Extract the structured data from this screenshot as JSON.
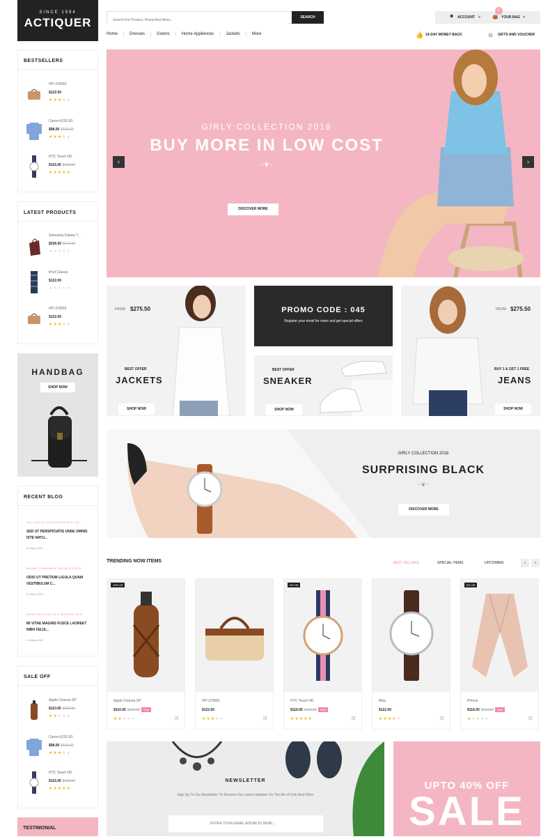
{
  "brand": {
    "since": "SINCE 1994",
    "name": "ACTIQUER"
  },
  "search": {
    "placeholder": "Search For Product, Brand And More...",
    "button": "SEARCH"
  },
  "header": {
    "account": "ACCOUNT",
    "bag": "YOUR BAG",
    "bag_count": "0",
    "perk1": "14-DAY MONEY BACK",
    "perk2": "GIFTS AND VOUCHER"
  },
  "nav": [
    "Home",
    "Dresses",
    "Gowns",
    "Home Appliences",
    "Jackets",
    "More"
  ],
  "bestsellers": {
    "title": "BESTSELLERS",
    "items": [
      {
        "name": "HP LP3065",
        "price": "$122.00",
        "old": "",
        "stars": 3
      },
      {
        "name": "Canon EOS 5D",
        "price": "$98.00",
        "old": "$122.00",
        "stars": 3
      },
      {
        "name": "HTC Touch HD",
        "price": "$116.00",
        "old": "$122.00",
        "stars": 5
      }
    ]
  },
  "latest": {
    "title": "LATEST PRODUCTS",
    "items": [
      {
        "name": "Samsung Galaxy T...",
        "price": "$236.00",
        "old": "$241.00",
        "stars": 0
      },
      {
        "name": "iPod Classic",
        "price": "$122.00",
        "old": "",
        "stars": 0
      },
      {
        "name": "HP LP3065",
        "price": "$122.00",
        "old": "",
        "stars": 3
      }
    ]
  },
  "handbag": {
    "title": "HANDBAG",
    "button": "SHOP NOW"
  },
  "blog": {
    "title": "RECENT BLOG",
    "posts": [
      {
        "cat": "NULLAM ULLAMCORPER NISI QU...",
        "title": "SED UT PERSPICIATIS UNDE OMNIS ISTE NATU...",
        "date": "21-May-2018"
      },
      {
        "cat": "MORBI CONDIMENTUM MOLESTIE",
        "title": "ODIO UT PRETIUM LIGULA QUAM VESTIBULUM C...",
        "date": "21-May-2018"
      },
      {
        "cat": "URNA PRETIUM ELIT MAURIS CUR...",
        "title": "MI VITAE MAGNIS FUSCE LAOREET NIBH FELIS...",
        "date": "21-May-2018"
      }
    ]
  },
  "saleoff": {
    "title": "SALE OFF",
    "items": [
      {
        "name": "Apple Cinema 30\"",
        "price": "$110.00",
        "old": "$122.00",
        "stars": 2
      },
      {
        "name": "Canon EOS 5D",
        "price": "$98.00",
        "old": "$122.00",
        "stars": 3
      },
      {
        "name": "HTC Touch HD",
        "price": "$116.00",
        "old": "$122.00",
        "stars": 5
      }
    ]
  },
  "testimonial": {
    "title": "TESTIMONIAL"
  },
  "hero": {
    "sub": "GIRLY COLLECTION 2018",
    "title": "BUY MORE IN LOW COST",
    "button": "DISCOVER MORE"
  },
  "banners": {
    "jackets": {
      "from": "FROM",
      "price": "$275.50",
      "offer": "BEST OFFER",
      "title": "JACKETS",
      "button": "SHOP NOW"
    },
    "promo": {
      "title": "PROMO CODE : 045",
      "text": "Register your email for news and get special offers"
    },
    "sneaker": {
      "offer": "BEST OFFER",
      "title": "SNEAKER",
      "button": "SHOP NOW"
    },
    "jeans": {
      "from": "FROM",
      "price": "$275.50",
      "offer": "BUY 1 & GET 1 FREE",
      "title": "JEANS",
      "button": "SHOP NOW"
    }
  },
  "watch_banner": {
    "sub": "GIRLY COLLECTION 2018",
    "title": "SURPRISING BLACK",
    "button": "DISCOVER MORE"
  },
  "trending": {
    "title": "TRENDING NOW ITEMS",
    "tabs": [
      "BEST SELLERS",
      "SPECIAL ITEMS",
      "UPCOMING"
    ],
    "items": [
      {
        "name": "Apple Cinema 30\"",
        "price": "$110.00",
        "old": "$122.00",
        "sale": "Sale",
        "tag": "10% Off",
        "stars": 2
      },
      {
        "name": "HP LP3065",
        "price": "$122.00",
        "old": "",
        "sale": "",
        "tag": "",
        "stars": 3
      },
      {
        "name": "HTC Touch HD",
        "price": "$116.00",
        "old": "$122.00",
        "sale": "Sale",
        "tag": "5% Off",
        "stars": 5
      },
      {
        "name": "iMac",
        "price": "$122.00",
        "old": "",
        "sale": "",
        "tag": "",
        "stars": 4
      },
      {
        "name": "iPhone",
        "price": "$116.00",
        "old": "$122.00",
        "sale": "Sale",
        "tag": "6% Off",
        "stars": 1
      }
    ]
  },
  "newsletter": {
    "title": "NEWSLETTER",
    "text": "Sign Up To Our Newsletter To Receive Our Latest Updates On The Art of Coin And Other",
    "placeholder": "ENTER YOUR EMAIL ADDRESS HERE..."
  },
  "sale_banner": {
    "top": "UPTO 40% OFF",
    "big": "SALE"
  },
  "colors": {
    "accent": "#f18aa0",
    "dark": "#222222",
    "hero_bg": "#f4b6c2"
  }
}
